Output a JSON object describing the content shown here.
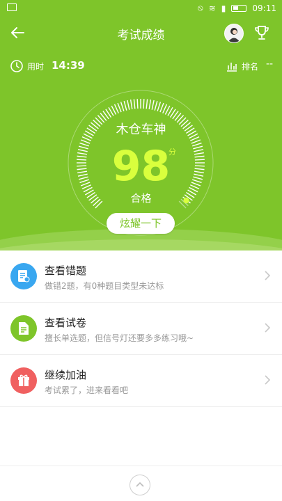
{
  "status_bar": {
    "time": "09:11"
  },
  "header": {
    "title": "考试成绩",
    "time_label": "用时",
    "time_value": "14:39",
    "rank_label": "排名",
    "rank_value": "--",
    "nickname": "木仓车神",
    "score": "98",
    "score_unit": "分",
    "result": "合格",
    "share_button": "炫耀一下"
  },
  "list": {
    "items": [
      {
        "title": "查看错题",
        "desc": "做错2题，有0种题目类型未达标",
        "color": "#39a7f0"
      },
      {
        "title": "查看试卷",
        "desc": "擅长单选题，但信号灯还要多多练习哦~",
        "color": "#7ec52a"
      },
      {
        "title": "继续加油",
        "desc": "考试累了，进来看看吧",
        "color": "#f06060"
      }
    ]
  },
  "colors": {
    "brand_green": "#7ec52a",
    "score_yellow": "#d9ff3d",
    "muted": "#999999"
  },
  "icons": [
    "back-arrow-icon",
    "trophy-icon",
    "clock-icon",
    "rank-chart-icon",
    "wrong-question-icon",
    "paper-icon",
    "gift-icon",
    "chevron-right-icon",
    "chevron-up-icon"
  ]
}
